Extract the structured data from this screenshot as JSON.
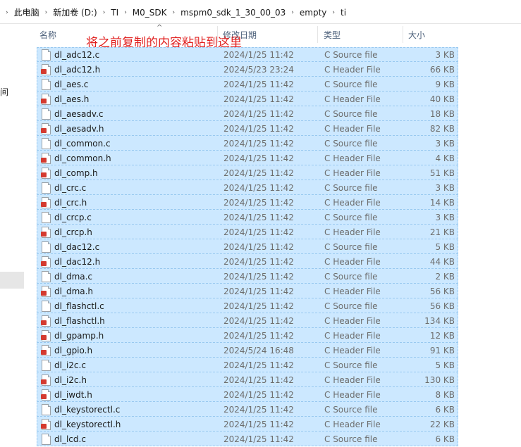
{
  "breadcrumb": [
    "此电脑",
    "新加卷 (D:)",
    "TI",
    "M0_SDK",
    "mspm0_sdk_1_30_00_03",
    "empty",
    "ti"
  ],
  "left_pane": {
    "label": "间"
  },
  "columns": {
    "name": "名称",
    "date": "修改日期",
    "type": "类型",
    "size": "大小"
  },
  "annotation": "将之前复制的内容粘贴到这里",
  "colors": {
    "selection": "#cce8ff",
    "annotation": "#e0201f"
  },
  "files": [
    {
      "name": "dl_adc12.c",
      "date": "2024/1/25 11:42",
      "type": "C Source file",
      "size": "3 KB",
      "icon": "c-source-file-icon"
    },
    {
      "name": "dl_adc12.h",
      "date": "2024/5/23 23:24",
      "type": "C Header File",
      "size": "66 KB",
      "icon": "c-header-file-icon"
    },
    {
      "name": "dl_aes.c",
      "date": "2024/1/25 11:42",
      "type": "C Source file",
      "size": "9 KB",
      "icon": "c-source-file-icon"
    },
    {
      "name": "dl_aes.h",
      "date": "2024/1/25 11:42",
      "type": "C Header File",
      "size": "40 KB",
      "icon": "c-header-file-icon"
    },
    {
      "name": "dl_aesadv.c",
      "date": "2024/1/25 11:42",
      "type": "C Source file",
      "size": "18 KB",
      "icon": "c-source-file-icon"
    },
    {
      "name": "dl_aesadv.h",
      "date": "2024/1/25 11:42",
      "type": "C Header File",
      "size": "82 KB",
      "icon": "c-header-file-icon"
    },
    {
      "name": "dl_common.c",
      "date": "2024/1/25 11:42",
      "type": "C Source file",
      "size": "3 KB",
      "icon": "c-source-file-icon"
    },
    {
      "name": "dl_common.h",
      "date": "2024/1/25 11:42",
      "type": "C Header File",
      "size": "4 KB",
      "icon": "c-header-file-icon"
    },
    {
      "name": "dl_comp.h",
      "date": "2024/1/25 11:42",
      "type": "C Header File",
      "size": "51 KB",
      "icon": "c-header-file-icon"
    },
    {
      "name": "dl_crc.c",
      "date": "2024/1/25 11:42",
      "type": "C Source file",
      "size": "3 KB",
      "icon": "c-source-file-icon"
    },
    {
      "name": "dl_crc.h",
      "date": "2024/1/25 11:42",
      "type": "C Header File",
      "size": "14 KB",
      "icon": "c-header-file-icon"
    },
    {
      "name": "dl_crcp.c",
      "date": "2024/1/25 11:42",
      "type": "C Source file",
      "size": "3 KB",
      "icon": "c-source-file-icon"
    },
    {
      "name": "dl_crcp.h",
      "date": "2024/1/25 11:42",
      "type": "C Header File",
      "size": "21 KB",
      "icon": "c-header-file-icon"
    },
    {
      "name": "dl_dac12.c",
      "date": "2024/1/25 11:42",
      "type": "C Source file",
      "size": "5 KB",
      "icon": "c-source-file-icon"
    },
    {
      "name": "dl_dac12.h",
      "date": "2024/1/25 11:42",
      "type": "C Header File",
      "size": "44 KB",
      "icon": "c-header-file-icon"
    },
    {
      "name": "dl_dma.c",
      "date": "2024/1/25 11:42",
      "type": "C Source file",
      "size": "2 KB",
      "icon": "c-source-file-icon"
    },
    {
      "name": "dl_dma.h",
      "date": "2024/1/25 11:42",
      "type": "C Header File",
      "size": "56 KB",
      "icon": "c-header-file-icon"
    },
    {
      "name": "dl_flashctl.c",
      "date": "2024/1/25 11:42",
      "type": "C Source file",
      "size": "56 KB",
      "icon": "c-source-file-icon"
    },
    {
      "name": "dl_flashctl.h",
      "date": "2024/1/25 11:42",
      "type": "C Header File",
      "size": "134 KB",
      "icon": "c-header-file-icon"
    },
    {
      "name": "dl_gpamp.h",
      "date": "2024/1/25 11:42",
      "type": "C Header File",
      "size": "12 KB",
      "icon": "c-header-file-icon"
    },
    {
      "name": "dl_gpio.h",
      "date": "2024/5/24 16:48",
      "type": "C Header File",
      "size": "91 KB",
      "icon": "c-header-file-icon"
    },
    {
      "name": "dl_i2c.c",
      "date": "2024/1/25 11:42",
      "type": "C Source file",
      "size": "5 KB",
      "icon": "c-source-file-icon"
    },
    {
      "name": "dl_i2c.h",
      "date": "2024/1/25 11:42",
      "type": "C Header File",
      "size": "130 KB",
      "icon": "c-header-file-icon"
    },
    {
      "name": "dl_iwdt.h",
      "date": "2024/1/25 11:42",
      "type": "C Header File",
      "size": "8 KB",
      "icon": "c-header-file-icon"
    },
    {
      "name": "dl_keystorectl.c",
      "date": "2024/1/25 11:42",
      "type": "C Source file",
      "size": "6 KB",
      "icon": "c-source-file-icon"
    },
    {
      "name": "dl_keystorectl.h",
      "date": "2024/1/25 11:42",
      "type": "C Header File",
      "size": "22 KB",
      "icon": "c-header-file-icon"
    },
    {
      "name": "dl_lcd.c",
      "date": "2024/1/25 11:42",
      "type": "C Source file",
      "size": "6 KB",
      "icon": "c-source-file-icon"
    }
  ]
}
